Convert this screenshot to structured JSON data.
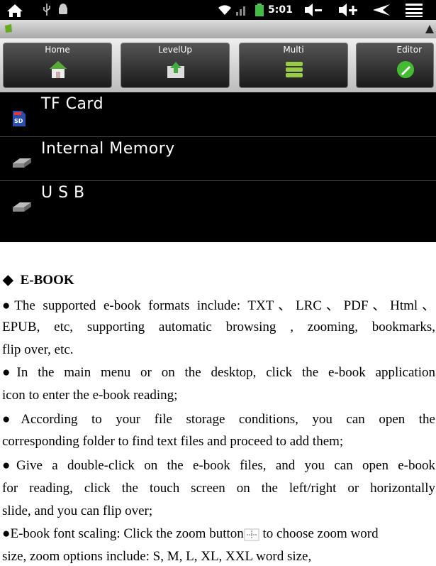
{
  "status": {
    "time": "5:01"
  },
  "toolbar": {
    "buttons": [
      {
        "label": "Home"
      },
      {
        "label": "LevelUp"
      },
      {
        "label": "Multi"
      },
      {
        "label": "Editor"
      }
    ]
  },
  "storage": {
    "items": [
      {
        "label": "TF Card",
        "icon": "sd-card-icon"
      },
      {
        "label": "Internal Memory",
        "icon": "drive-icon"
      },
      {
        "label": "U S B",
        "icon": "drive-icon"
      }
    ]
  },
  "doc": {
    "heading_bullet": "◆",
    "heading": "E-BOOK",
    "lines": [
      "●The supported e-book formats include: TXT、LRC、PDF、Html、",
      "EPUB, etc, supporting automatic browsing , zooming, bookmarks,",
      "flip over, etc.",
      "●In the main menu or on the desktop, click the e-book application",
      "icon to enter the e-book reading;",
      "●According to your file storage conditions, you can open the",
      "corresponding folder to find text files and proceed to add them;",
      "●Give a double-click on the e-book files, and you can open e-book",
      "for reading, click the touch screen on the left/right or horizontally",
      "slide, and you can flip over;",
      "●E-book font scaling: Click the zoom button",
      " to choose zoom word",
      "size, zoom options include: S, M, L, XL, XXL word size,"
    ]
  }
}
